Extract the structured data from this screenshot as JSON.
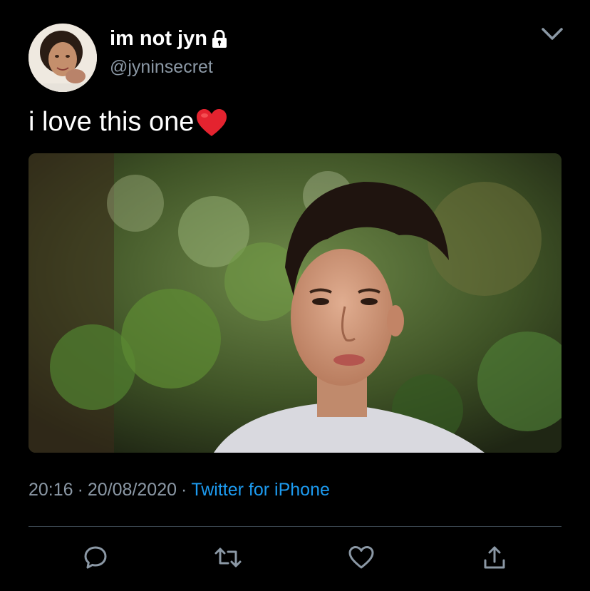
{
  "tweet": {
    "display_name": "im not jyn",
    "handle": "@jyninsecret",
    "text": "i love this one",
    "time": "20:16",
    "date": "20/08/2020",
    "separator": "·",
    "source": "Twitter for iPhone"
  },
  "icons": {
    "lock": "lock-icon",
    "menu": "chevron-down-icon",
    "emoji": "red-heart-emoji",
    "reply": "reply-icon",
    "retweet": "retweet-icon",
    "like": "like-icon",
    "share": "share-icon"
  },
  "colors": {
    "background": "#000000",
    "text": "#ffffff",
    "secondary": "#8b98a5",
    "link": "#1d9bf0",
    "divider": "#38444d"
  }
}
